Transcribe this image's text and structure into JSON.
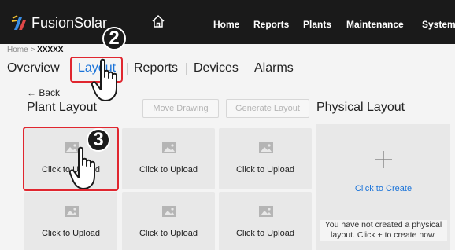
{
  "header": {
    "brand": "FusionSolar",
    "nav": [
      "Home",
      "Reports",
      "Plants",
      "Maintenance",
      "System"
    ]
  },
  "breadcrumb": {
    "home": "Home",
    "sep": ">",
    "current": "XXXXX"
  },
  "subnav": {
    "tabs": [
      "Overview",
      "Layout",
      "Reports",
      "Devices",
      "Alarms"
    ],
    "active": "Layout"
  },
  "steps": {
    "two": "2",
    "three": "3"
  },
  "plant_layout": {
    "back": "← Back",
    "title": "Plant Layout",
    "move_drawing": "Move Drawing",
    "generate_layout": "Generate Layout",
    "cards": [
      "Click to Upload",
      "Click to Upload",
      "Click to Upload",
      "Click to Upload",
      "Click to Upload",
      "Click to Upload"
    ]
  },
  "physical_layout": {
    "title": "Physical Layout",
    "create": "Click to Create",
    "empty_message": "You have not created a physical layout. Click + to create now."
  },
  "colors": {
    "accent": "#1a73d9",
    "highlight": "#e0262f",
    "topbar": "#1a1a1a"
  },
  "icons": {
    "logo": "fusionsolar-logo-icon",
    "home": "home-icon",
    "image": "image-placeholder-icon",
    "plus": "plus-icon",
    "hand": "pointing-hand-icon"
  }
}
